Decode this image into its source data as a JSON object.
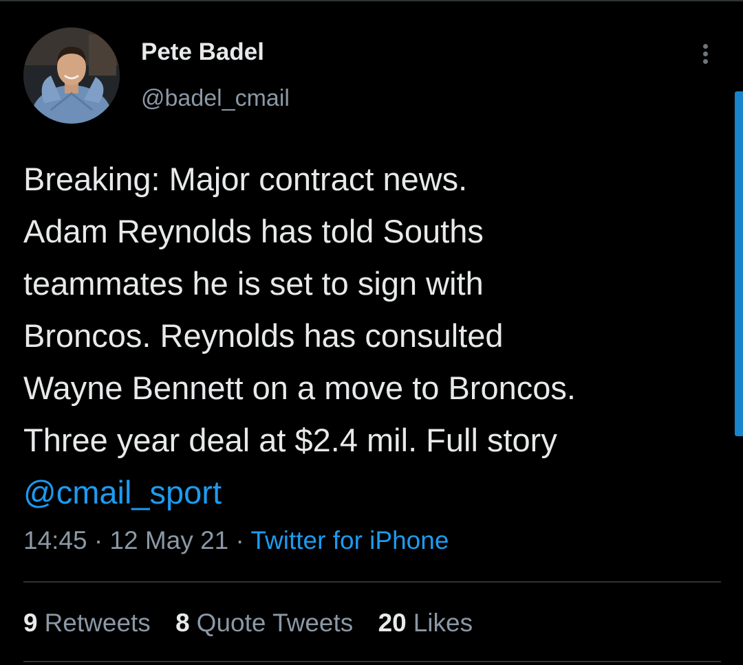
{
  "user": {
    "display_name": "Pete Badel",
    "handle": "@badel_cmail"
  },
  "header": {
    "more_icon": "more-vertical-icon"
  },
  "tweet": {
    "lines": [
      "Breaking: Major contract news.",
      "Adam Reynolds has told Souths",
      "teammates he is set to sign with",
      "Broncos. Reynolds has consulted",
      "Wayne Bennett on a move to Broncos.",
      "Three year deal at $2.4 mil. Full story"
    ],
    "mention": "@cmail_sport"
  },
  "meta": {
    "time": "14:45",
    "separator": " · ",
    "date": "12 May 21",
    "source": "Twitter for iPhone"
  },
  "stats": {
    "retweets": {
      "count": "9",
      "label": "Retweets"
    },
    "quotes": {
      "count": "8",
      "label": "Quote Tweets"
    },
    "likes": {
      "count": "20",
      "label": "Likes"
    }
  },
  "colors": {
    "background": "#000000",
    "text": "#e7e9ea",
    "secondary": "#8b98a5",
    "accent": "#1d9bf0",
    "divider": "#2f3336"
  }
}
